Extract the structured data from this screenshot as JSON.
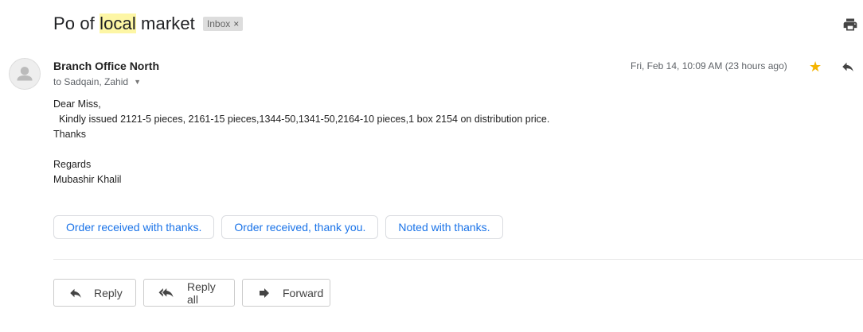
{
  "subject": {
    "before": "Po of ",
    "highlight": "local",
    "after": " market"
  },
  "label": {
    "text": "Inbox",
    "remove_glyph": "×"
  },
  "icons": {
    "print": "print-icon",
    "avatar": "person-icon",
    "star": "star-icon",
    "reply": "reply-icon",
    "reply_all": "reply-all-icon",
    "forward": "forward-icon",
    "caret": "chevron-down-icon"
  },
  "sender": {
    "name": "Branch Office North",
    "to": "to Sadqain, Zahid"
  },
  "date": "Fri, Feb 14, 10:09 AM (23 hours ago)",
  "body": {
    "lines": [
      "Dear Miss,",
      "  Kindly issued 2121-5 pieces, 2161-15 pieces,1344-50,1341-50,2164-10 pieces,1 box 2154 on distribution price.",
      "Thanks",
      "",
      "Regards",
      "Mubashir Khalil"
    ]
  },
  "smart_replies": [
    "Order received with thanks.",
    "Order received, thank you.",
    "Noted with thanks."
  ],
  "actions": {
    "reply": "Reply",
    "reply_all": "Reply all",
    "forward": "Forward"
  },
  "colors": {
    "star": "#f4b400",
    "link": "#1a73e8",
    "highlight": "#fdf6a5"
  }
}
